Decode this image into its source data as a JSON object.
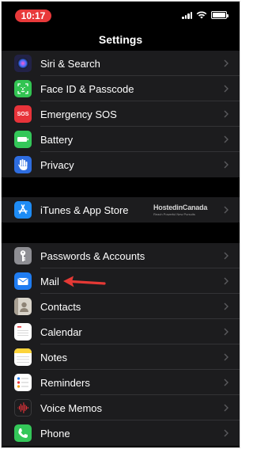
{
  "status_bar": {
    "time": "10:17",
    "signal_icon": "cellular-signal-icon",
    "wifi_icon": "wifi-icon",
    "battery_icon": "battery-icon"
  },
  "nav": {
    "title": "Settings"
  },
  "groups": [
    {
      "items": [
        {
          "label": "Siri & Search",
          "icon": "siri-icon",
          "color": "#2a2a5e"
        },
        {
          "label": "Face ID & Passcode",
          "icon": "face-id-icon",
          "color": "#32c452"
        },
        {
          "label": "Emergency SOS",
          "icon": "sos-icon",
          "color": "#e8333a",
          "icon_text": "SOS"
        },
        {
          "label": "Battery",
          "icon": "battery-settings-icon",
          "color": "#34c759"
        },
        {
          "label": "Privacy",
          "icon": "privacy-hand-icon",
          "color": "#2e6de0"
        }
      ]
    },
    {
      "items": [
        {
          "label": "iTunes & App Store",
          "icon": "app-store-icon",
          "color": "#1e8cf5"
        }
      ]
    },
    {
      "items": [
        {
          "label": "Passwords & Accounts",
          "icon": "key-icon",
          "color": "#8e8e93"
        },
        {
          "label": "Mail",
          "icon": "mail-icon",
          "color": "#1f7cf1"
        },
        {
          "label": "Contacts",
          "icon": "contacts-icon",
          "color": "#b9b4ab"
        },
        {
          "label": "Calendar",
          "icon": "calendar-icon",
          "color": "#ffffff"
        },
        {
          "label": "Notes",
          "icon": "notes-icon",
          "color": "#ffffff"
        },
        {
          "label": "Reminders",
          "icon": "reminders-icon",
          "color": "#ffffff"
        },
        {
          "label": "Voice Memos",
          "icon": "voice-memos-icon",
          "color": "#1c1c1e"
        },
        {
          "label": "Phone",
          "icon": "phone-icon",
          "color": "#34c759"
        }
      ]
    }
  ],
  "watermark": {
    "main": "HostedinCanada",
    "sub": "Reach Powerful New Pursuits"
  },
  "annotation": {
    "arrow_color": "#e53935"
  }
}
